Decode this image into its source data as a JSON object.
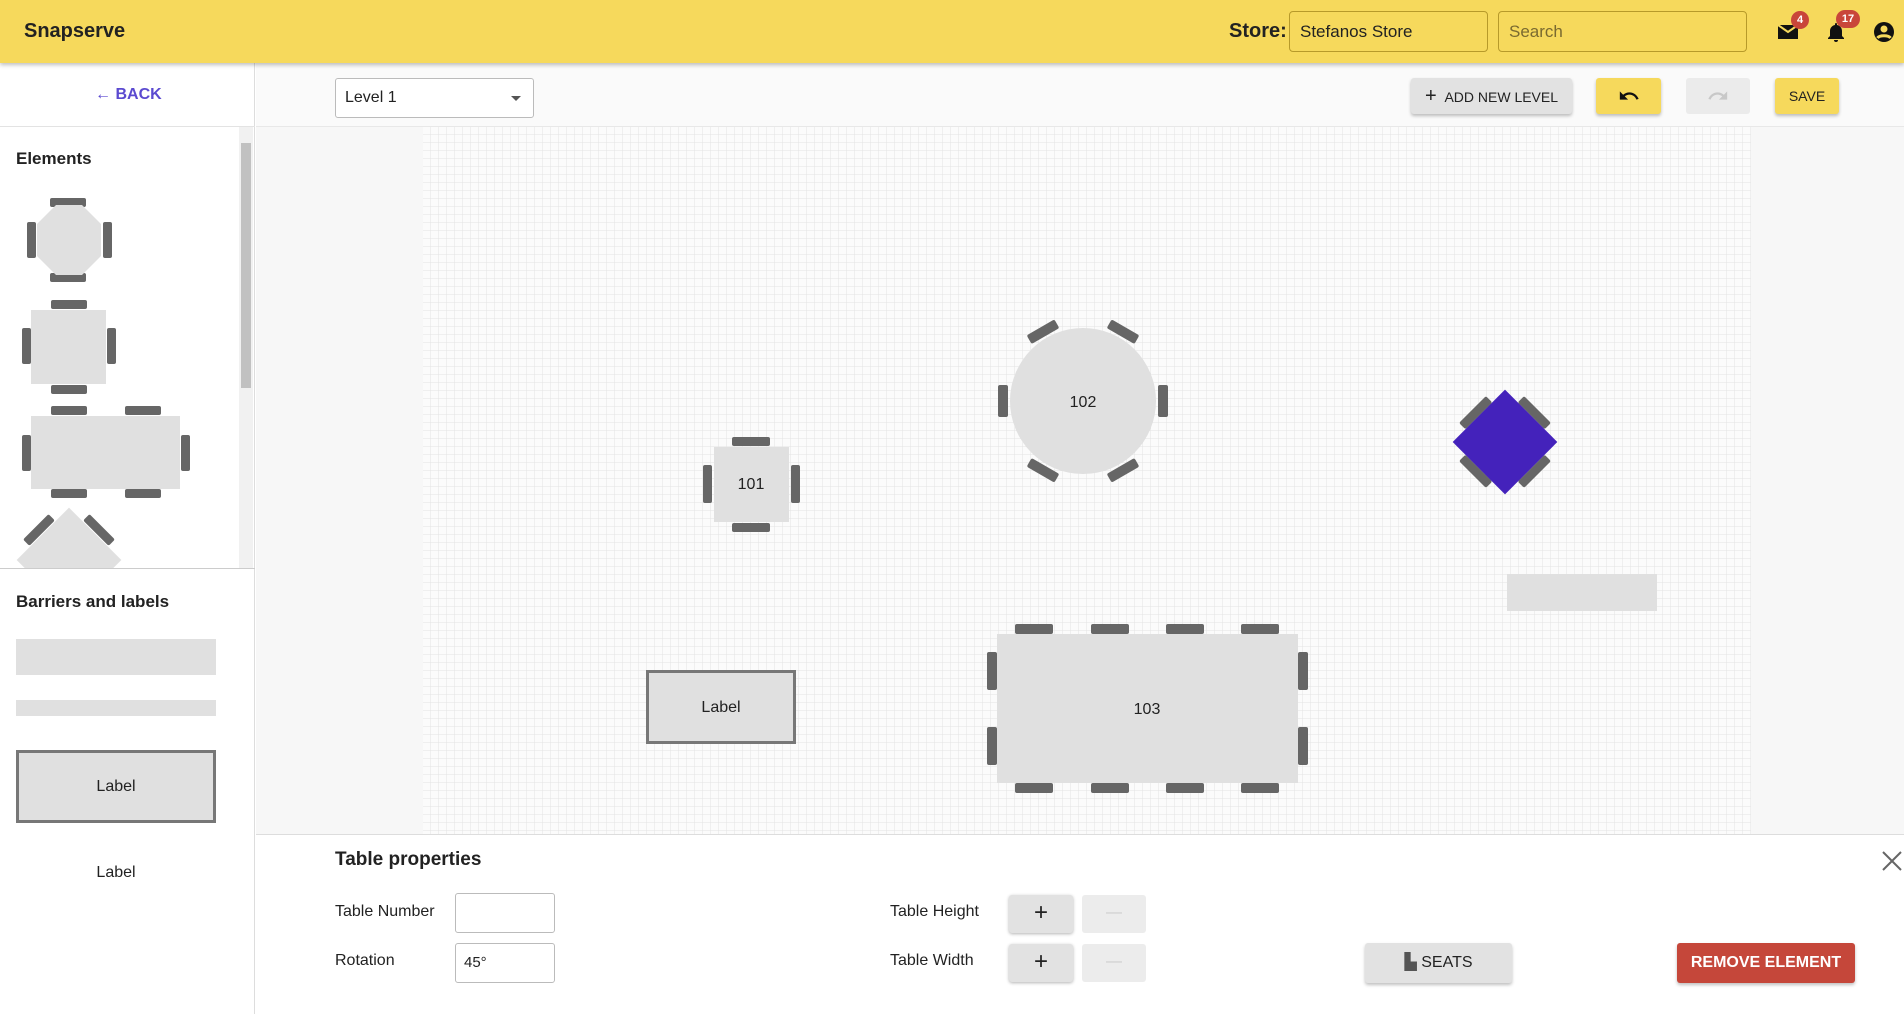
{
  "header": {
    "brand": "Snapserve",
    "store_label": "Store:",
    "store_value": "Stefanos Store",
    "search_placeholder": "Search",
    "mail_count": "4",
    "notification_count": "17"
  },
  "sidebar": {
    "back_label": "BACK",
    "elements_heading": "Elements",
    "barriers_heading": "Barriers and labels",
    "label_box_text": "Label",
    "label_text": "Label"
  },
  "toolbar": {
    "level_value": "Level 1",
    "add_level_label": "ADD NEW LEVEL",
    "save_label": "SAVE"
  },
  "canvas": {
    "tables": [
      {
        "number": "101"
      },
      {
        "number": "102"
      },
      {
        "number": "103"
      }
    ],
    "label_text": "Label",
    "selected_color": "#4422bb"
  },
  "panel": {
    "title": "Table properties",
    "table_number_label": "Table Number",
    "table_number_value": "",
    "rotation_label": "Rotation",
    "rotation_value": "45°",
    "table_height_label": "Table Height",
    "table_width_label": "Table Width",
    "plus": "+",
    "minus": "—",
    "seats_label": "SEATS",
    "remove_label": "REMOVE ELEMENT",
    "remove_color": "#c5473a"
  }
}
